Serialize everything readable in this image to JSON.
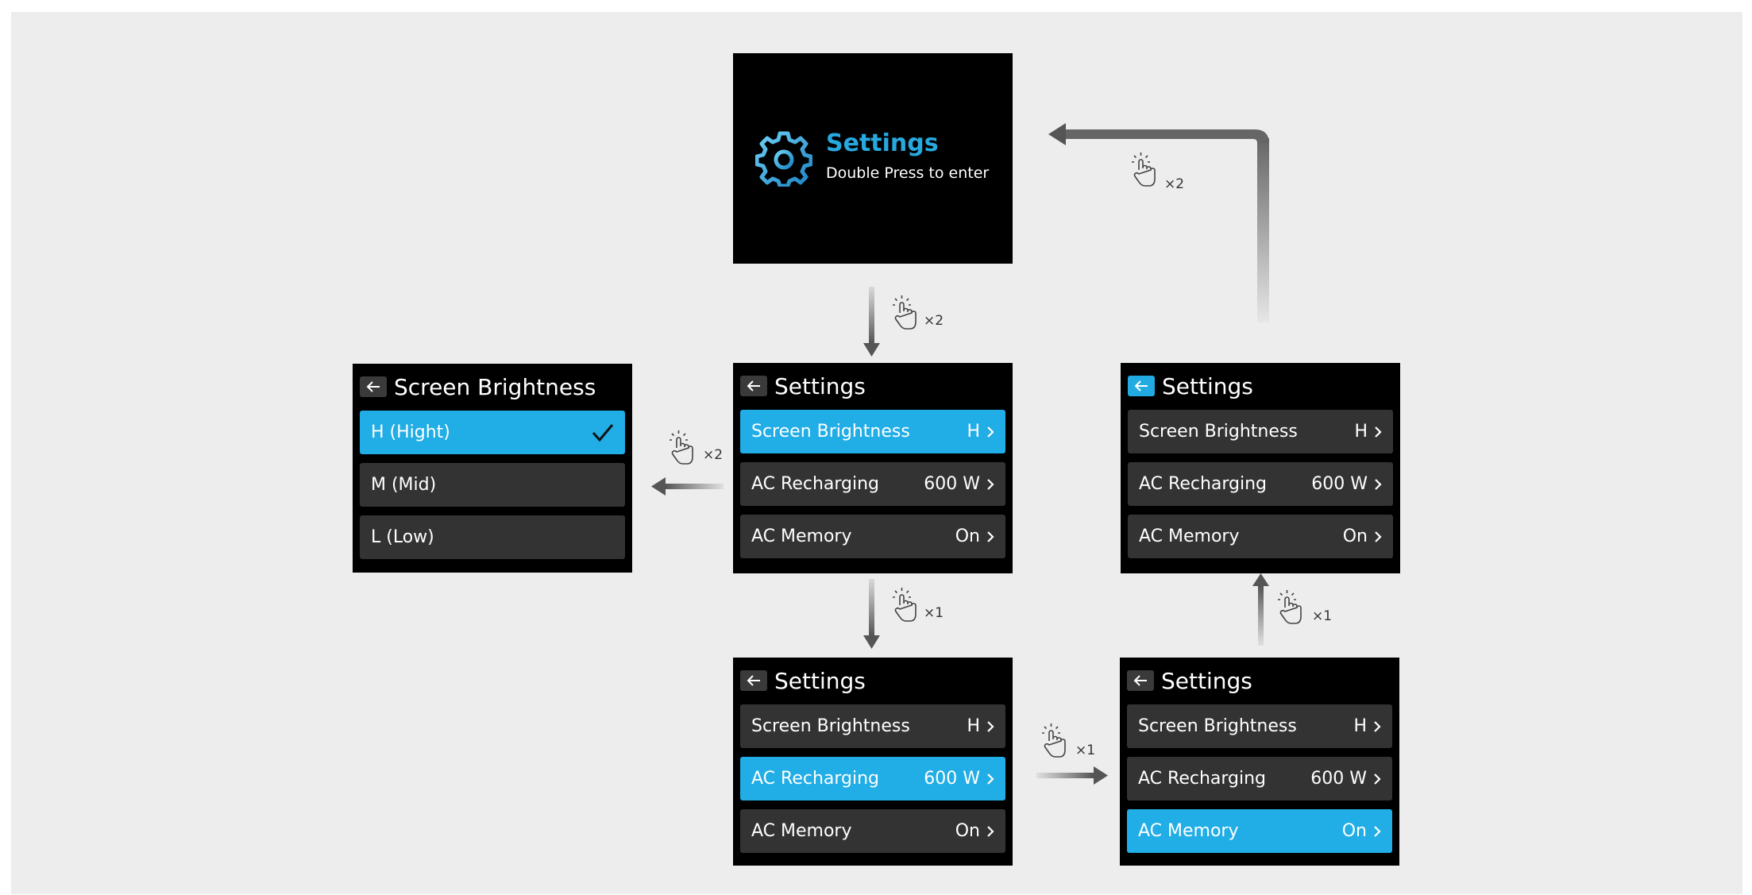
{
  "colors": {
    "background": "#ededed",
    "screen": "#000000",
    "row": "#333333",
    "accent": "#21ade5",
    "text": "#ffffff",
    "arrow": "#666666"
  },
  "splash": {
    "icon": "gear-icon",
    "title": "Settings",
    "subtitle": "Double Press to enter"
  },
  "screens": {
    "brightness": {
      "title": "Screen Brightness",
      "options": [
        {
          "label": "H (Hight)",
          "checked": true
        },
        {
          "label": "M (Mid)"
        },
        {
          "label": "L (Low)"
        }
      ]
    },
    "settings_a": {
      "title": "Settings",
      "items": [
        {
          "label": "Screen Brightness",
          "value": "H"
        },
        {
          "label": "AC Recharging",
          "value": "600 W"
        },
        {
          "label": "AC Memory",
          "value": "On"
        }
      ]
    },
    "settings_b": {
      "title": "Settings",
      "items": [
        {
          "label": "Screen Brightness",
          "value": "H"
        },
        {
          "label": "AC Recharging",
          "value": "600 W"
        },
        {
          "label": "AC Memory",
          "value": "On"
        }
      ]
    },
    "settings_c": {
      "title": "Settings",
      "items": [
        {
          "label": "Screen Brightness",
          "value": "H"
        },
        {
          "label": "AC Recharging",
          "value": "600 W"
        },
        {
          "label": "AC Memory",
          "value": "On"
        }
      ]
    },
    "settings_d": {
      "title": "Settings",
      "items": [
        {
          "label": "Screen Brightness",
          "value": "H"
        },
        {
          "label": "AC Recharging",
          "value": "600 W"
        },
        {
          "label": "AC Memory",
          "value": "On"
        }
      ]
    }
  },
  "presses": {
    "splash_to_settings": "×2",
    "settings_to_brightness": "×2",
    "down_a_to_b": "×1",
    "right_b_to_c": "×1",
    "up_c_to_d": "×1",
    "d_to_splash": "×2"
  }
}
